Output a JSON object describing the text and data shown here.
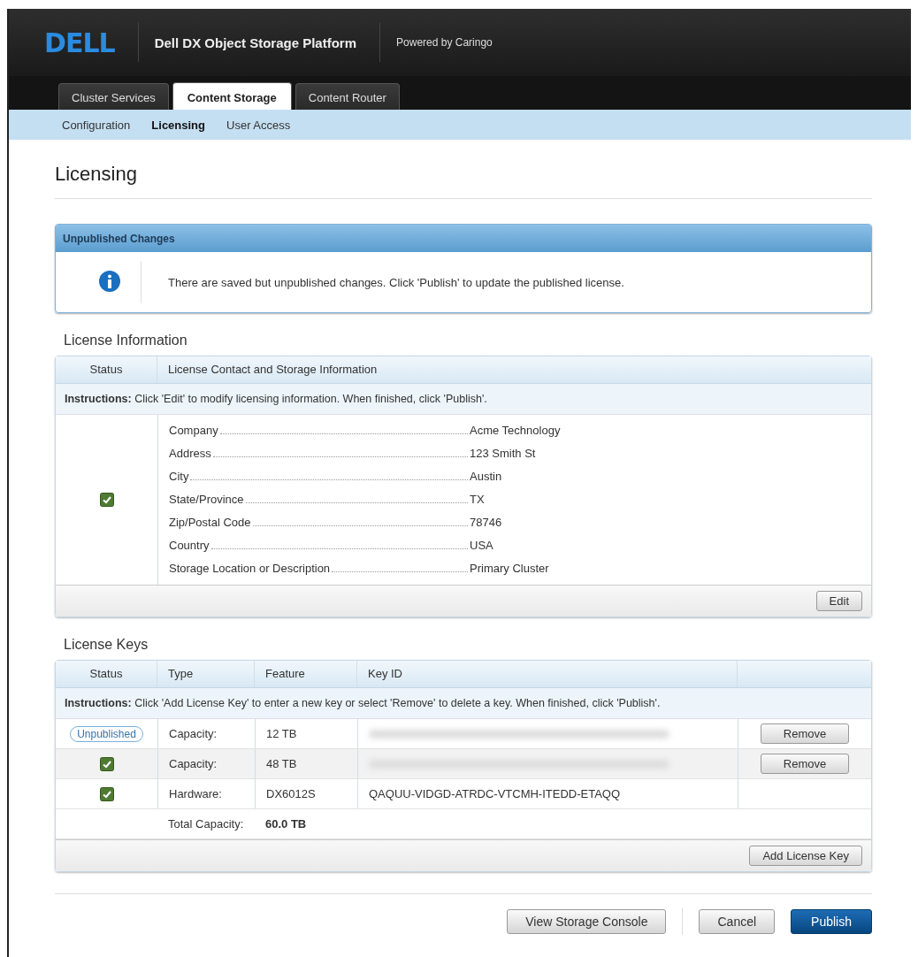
{
  "header": {
    "logo": "DELL",
    "product": "Dell DX Object Storage Platform",
    "powered_by": "Powered by Caringo"
  },
  "tabs": [
    {
      "label": "Cluster Services",
      "selected": false
    },
    {
      "label": "Content Storage",
      "selected": true
    },
    {
      "label": "Content Router",
      "selected": false
    }
  ],
  "subnav": [
    {
      "label": "Configuration",
      "selected": false
    },
    {
      "label": "Licensing",
      "selected": true
    },
    {
      "label": "User Access",
      "selected": false
    }
  ],
  "page_title": "Licensing",
  "notice": {
    "title": "Unpublished Changes",
    "message": "There are saved but unpublished changes. Click 'Publish' to update the published license."
  },
  "license_information": {
    "title": "License Information",
    "columns": [
      "Status",
      "License Contact and Storage Information"
    ],
    "instructions": "**Instructions:** Click 'Edit' to modify licensing information. When finished, click 'Publish'.",
    "status_ok": true,
    "fields": [
      {
        "label": "Company",
        "value": "Acme Technology"
      },
      {
        "label": "Address",
        "value": "123 Smith St"
      },
      {
        "label": "City",
        "value": "Austin"
      },
      {
        "label": "State/Province",
        "value": "TX"
      },
      {
        "label": "Zip/Postal Code",
        "value": "78746"
      },
      {
        "label": "Country",
        "value": "USA"
      },
      {
        "label": "Storage Location or Description",
        "value": "Primary Cluster"
      }
    ],
    "button": "Edit"
  },
  "license_keys": {
    "title": "License Keys",
    "columns": [
      "Status",
      "Type",
      "Feature",
      "Key ID"
    ],
    "instructions": "**Instructions:** Click 'Add License Key' to enter a new key or select 'Remove' to delete a key. When finished, click 'Publish'.",
    "rows": [
      {
        "status": {
          "kind": "badge",
          "label": "Unpublished"
        },
        "type": "Capacity:",
        "feature": "12 TB",
        "key_id_blurred": true,
        "action": "Remove"
      },
      {
        "status": {
          "kind": "check"
        },
        "type": "Capacity:",
        "feature": "48 TB",
        "key_id_blurred": true,
        "action": "Remove"
      },
      {
        "status": {
          "kind": "check"
        },
        "type": "Hardware:",
        "feature": "DX6012S",
        "key_id": "QAQUU-VIDGD-ATRDC-VTCMH-ITEDD-ETAQQ"
      }
    ],
    "total_label": "Total Capacity:",
    "total_value": "60.0 TB",
    "button": "Add License Key"
  },
  "footer_buttons": [
    {
      "label": "View Storage Console",
      "kind": "default"
    },
    {
      "label": "Cancel",
      "kind": "default"
    },
    {
      "label": "Publish",
      "kind": "primary"
    }
  ]
}
